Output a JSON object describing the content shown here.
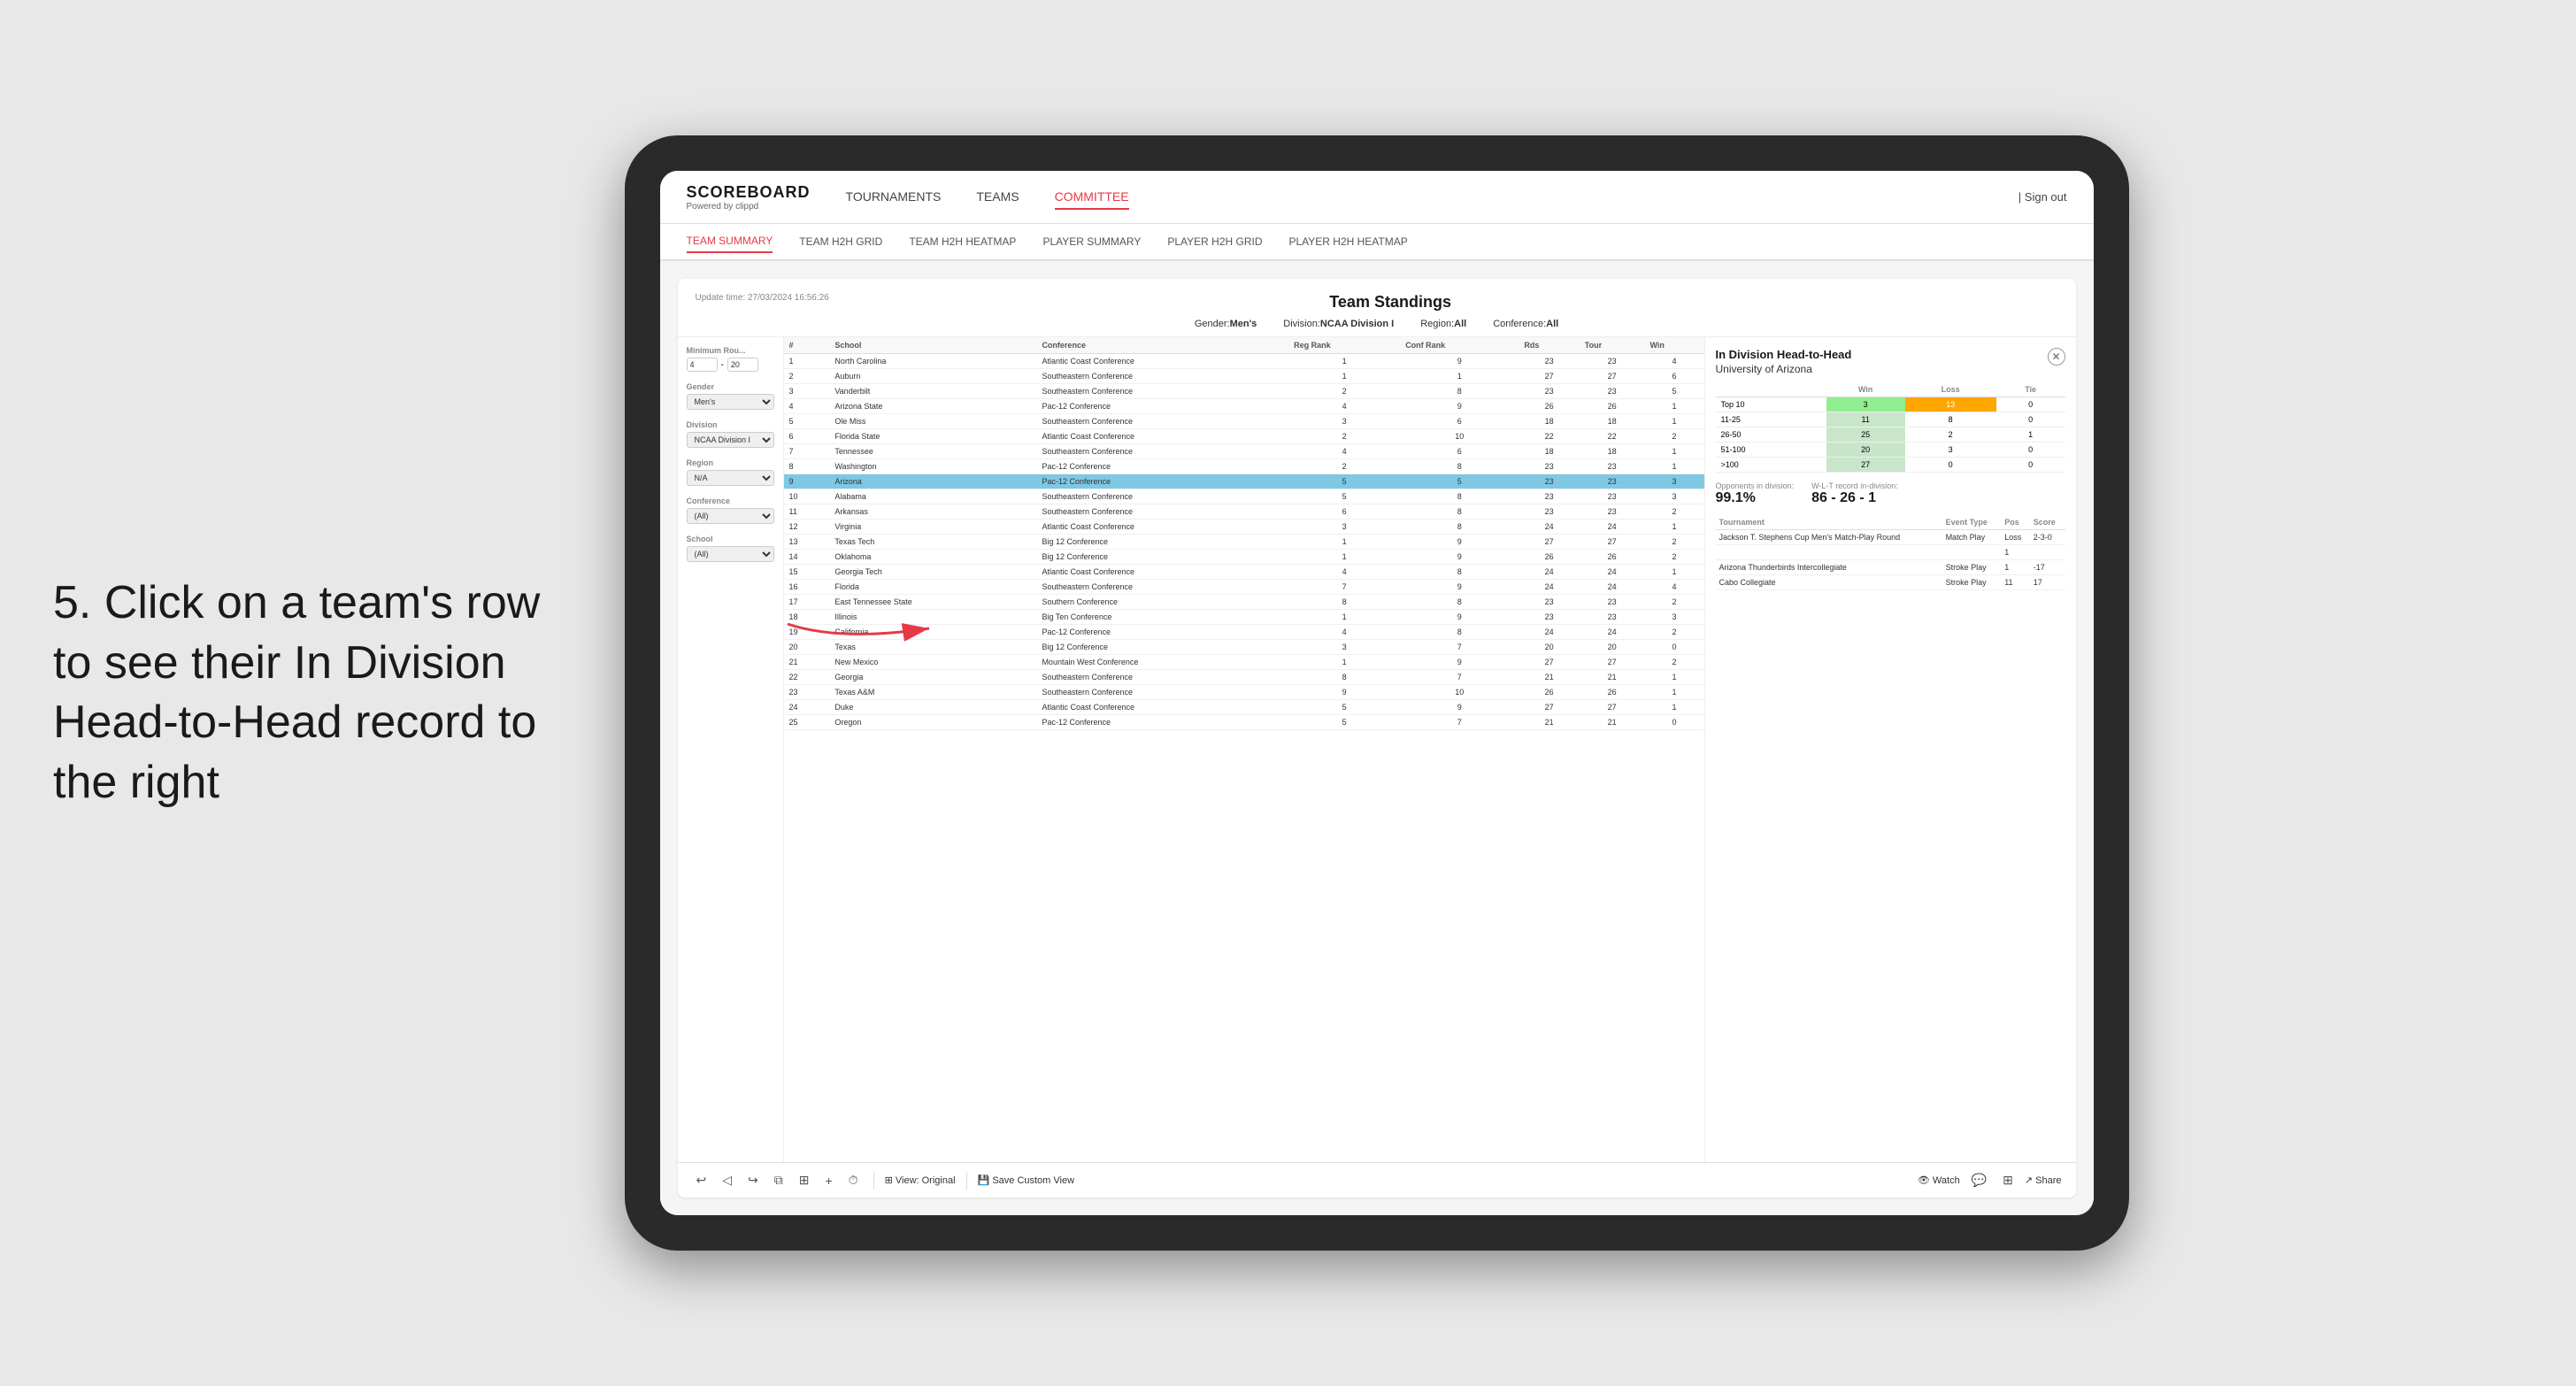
{
  "instruction": {
    "text": "5. Click on a team's row to see their In Division Head-to-Head record to the right"
  },
  "nav": {
    "logo": "SCOREBOARD",
    "logo_subtitle": "Powered by clippd",
    "items": [
      "TOURNAMENTS",
      "TEAMS",
      "COMMITTEE"
    ],
    "active": "COMMITTEE",
    "sign_out": "Sign out"
  },
  "sub_nav": {
    "items": [
      "TEAM SUMMARY",
      "TEAM H2H GRID",
      "TEAM H2H HEATMAP",
      "PLAYER SUMMARY",
      "PLAYER H2H GRID",
      "PLAYER H2H HEATMAP"
    ],
    "active": "PLAYER SUMMARY"
  },
  "card": {
    "update_time": "Update time: 27/03/2024 16:56:26",
    "title": "Team Standings",
    "gender": "Men's",
    "division": "NCAA Division I",
    "region": "All",
    "conference": "All"
  },
  "filters": {
    "min_rounds_label": "Minimum Rou...",
    "min_rounds_value": "4",
    "max_rounds_value": "20",
    "gender_label": "Gender",
    "gender_value": "Men's",
    "division_label": "Division",
    "division_value": "NCAA Division I",
    "region_label": "Region",
    "region_value": "N/A",
    "conference_label": "Conference",
    "conference_value": "(All)",
    "school_label": "School",
    "school_value": "(All)"
  },
  "table": {
    "headers": [
      "#",
      "School",
      "Conference",
      "Reg Rank",
      "Conf Rank",
      "Rds",
      "Tour",
      "Win"
    ],
    "rows": [
      {
        "num": 1,
        "school": "North Carolina",
        "conference": "Atlantic Coast Conference",
        "reg_rank": 1,
        "conf_rank": 9,
        "rds": 23,
        "tour": 23,
        "win": 4
      },
      {
        "num": 2,
        "school": "Auburn",
        "conference": "Southeastern Conference",
        "reg_rank": 1,
        "conf_rank": 1,
        "rds": 27,
        "tour": 27,
        "win": 6
      },
      {
        "num": 3,
        "school": "Vanderbilt",
        "conference": "Southeastern Conference",
        "reg_rank": 2,
        "conf_rank": 8,
        "rds": 23,
        "tour": 23,
        "win": 5
      },
      {
        "num": 4,
        "school": "Arizona State",
        "conference": "Pac-12 Conference",
        "reg_rank": 4,
        "conf_rank": 9,
        "rds": 26,
        "tour": 26,
        "win": 1
      },
      {
        "num": 5,
        "school": "Ole Miss",
        "conference": "Southeastern Conference",
        "reg_rank": 3,
        "conf_rank": 6,
        "rds": 18,
        "tour": 18,
        "win": 1
      },
      {
        "num": 6,
        "school": "Florida State",
        "conference": "Atlantic Coast Conference",
        "reg_rank": 2,
        "conf_rank": 10,
        "rds": 22,
        "tour": 22,
        "win": 2
      },
      {
        "num": 7,
        "school": "Tennessee",
        "conference": "Southeastern Conference",
        "reg_rank": 4,
        "conf_rank": 6,
        "rds": 18,
        "tour": 18,
        "win": 1
      },
      {
        "num": 8,
        "school": "Washington",
        "conference": "Pac-12 Conference",
        "reg_rank": 2,
        "conf_rank": 8,
        "rds": 23,
        "tour": 23,
        "win": 1
      },
      {
        "num": 9,
        "school": "Arizona",
        "conference": "Pac-12 Conference",
        "reg_rank": 5,
        "conf_rank": 5,
        "rds": 23,
        "tour": 23,
        "win": 3,
        "highlighted": true
      },
      {
        "num": 10,
        "school": "Alabama",
        "conference": "Southeastern Conference",
        "reg_rank": 5,
        "conf_rank": 8,
        "rds": 23,
        "tour": 23,
        "win": 3
      },
      {
        "num": 11,
        "school": "Arkansas",
        "conference": "Southeastern Conference",
        "reg_rank": 6,
        "conf_rank": 8,
        "rds": 23,
        "tour": 23,
        "win": 2
      },
      {
        "num": 12,
        "school": "Virginia",
        "conference": "Atlantic Coast Conference",
        "reg_rank": 3,
        "conf_rank": 8,
        "rds": 24,
        "tour": 24,
        "win": 1
      },
      {
        "num": 13,
        "school": "Texas Tech",
        "conference": "Big 12 Conference",
        "reg_rank": 1,
        "conf_rank": 9,
        "rds": 27,
        "tour": 27,
        "win": 2
      },
      {
        "num": 14,
        "school": "Oklahoma",
        "conference": "Big 12 Conference",
        "reg_rank": 1,
        "conf_rank": 9,
        "rds": 26,
        "tour": 26,
        "win": 2
      },
      {
        "num": 15,
        "school": "Georgia Tech",
        "conference": "Atlantic Coast Conference",
        "reg_rank": 4,
        "conf_rank": 8,
        "rds": 24,
        "tour": 24,
        "win": 1
      },
      {
        "num": 16,
        "school": "Florida",
        "conference": "Southeastern Conference",
        "reg_rank": 7,
        "conf_rank": 9,
        "rds": 24,
        "tour": 24,
        "win": 4
      },
      {
        "num": 17,
        "school": "East Tennessee State",
        "conference": "Southern Conference",
        "reg_rank": 8,
        "conf_rank": 8,
        "rds": 23,
        "tour": 23,
        "win": 2
      },
      {
        "num": 18,
        "school": "Illinois",
        "conference": "Big Ten Conference",
        "reg_rank": 1,
        "conf_rank": 9,
        "rds": 23,
        "tour": 23,
        "win": 3
      },
      {
        "num": 19,
        "school": "California",
        "conference": "Pac-12 Conference",
        "reg_rank": 4,
        "conf_rank": 8,
        "rds": 24,
        "tour": 24,
        "win": 2
      },
      {
        "num": 20,
        "school": "Texas",
        "conference": "Big 12 Conference",
        "reg_rank": 3,
        "conf_rank": 7,
        "rds": 20,
        "tour": 20,
        "win": 0
      },
      {
        "num": 21,
        "school": "New Mexico",
        "conference": "Mountain West Conference",
        "reg_rank": 1,
        "conf_rank": 9,
        "rds": 27,
        "tour": 27,
        "win": 2
      },
      {
        "num": 22,
        "school": "Georgia",
        "conference": "Southeastern Conference",
        "reg_rank": 8,
        "conf_rank": 7,
        "rds": 21,
        "tour": 21,
        "win": 1
      },
      {
        "num": 23,
        "school": "Texas A&M",
        "conference": "Southeastern Conference",
        "reg_rank": 9,
        "conf_rank": 10,
        "rds": 26,
        "tour": 26,
        "win": 1
      },
      {
        "num": 24,
        "school": "Duke",
        "conference": "Atlantic Coast Conference",
        "reg_rank": 5,
        "conf_rank": 9,
        "rds": 27,
        "tour": 27,
        "win": 1
      },
      {
        "num": 25,
        "school": "Oregon",
        "conference": "Pac-12 Conference",
        "reg_rank": 5,
        "conf_rank": 7,
        "rds": 21,
        "tour": 21,
        "win": 0
      }
    ]
  },
  "h2h": {
    "title": "In Division Head-to-Head",
    "team": "University of Arizona",
    "headers": [
      "",
      "Win",
      "Loss",
      "Tie"
    ],
    "rows": [
      {
        "range": "Top 10",
        "win": 3,
        "loss": 13,
        "tie": 0,
        "win_color": "green",
        "loss_color": "orange"
      },
      {
        "range": "11-25",
        "win": 11,
        "loss": 8,
        "tie": 0,
        "win_color": "light_green"
      },
      {
        "range": "26-50",
        "win": 25,
        "loss": 2,
        "tie": 1,
        "win_color": "light_green"
      },
      {
        "range": "51-100",
        "win": 20,
        "loss": 3,
        "tie": 0,
        "win_color": "light_green"
      },
      {
        "range": ">100",
        "win": 27,
        "loss": 0,
        "tie": 0,
        "win_color": "light_green"
      }
    ],
    "opponents_label": "Opponents in division:",
    "opponents_value": "99.1%",
    "wlt_label": "W-L-T record in-division:",
    "wlt_value": "86 - 26 - 1",
    "tournaments": {
      "headers": [
        "Tournament",
        "Event Type",
        "Pos",
        "Score"
      ],
      "rows": [
        {
          "tournament": "Jackson T. Stephens Cup Men's Match-Play Round",
          "event_type": "Match Play",
          "pos": "Loss",
          "score": "2-3-0"
        },
        {
          "tournament": "",
          "event_type": "",
          "pos": "1",
          "score": ""
        },
        {
          "tournament": "Arizona Thunderbirds Intercollegiate",
          "event_type": "Stroke Play",
          "pos": "1",
          "score": "-17"
        },
        {
          "tournament": "Cabo Collegiate",
          "event_type": "Stroke Play",
          "pos": "11",
          "score": "17"
        }
      ]
    }
  },
  "toolbar": {
    "undo": "↩",
    "redo": "↪",
    "view_original": "View: Original",
    "save_custom": "Save Custom View",
    "watch": "Watch",
    "share": "Share"
  }
}
